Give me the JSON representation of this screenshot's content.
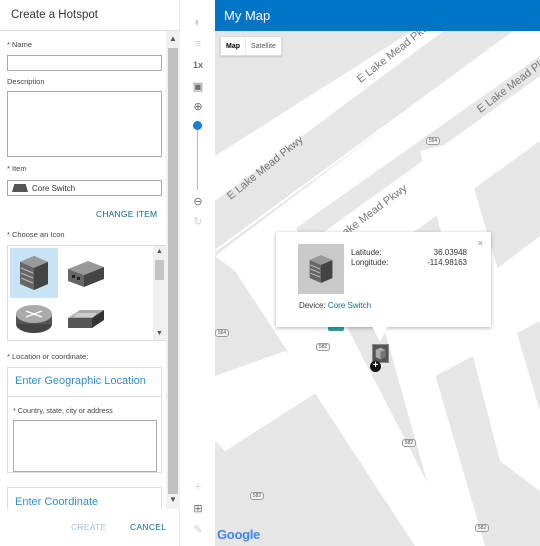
{
  "panel": {
    "title": "Create a Hotspot",
    "name_label": "* Name",
    "name_value": "",
    "description_label": "Description",
    "description_value": "",
    "item_label": "* Item",
    "item_value": "Core Switch",
    "change_item": "CHANGE ITEM",
    "choose_icon_label": "* Choose an Icon",
    "icons": [
      "server-icon",
      "building-icon",
      "router-icon",
      "switch-icon"
    ],
    "location_label": "* Location or coordinate:",
    "geo_location_title": "Enter Geographic Location",
    "geo_location_hint": "* Country, state, city or address",
    "coordinate_title": "Enter Coordinate",
    "create_button": "CREATE",
    "cancel_button": "CANCEL"
  },
  "map": {
    "title": "My Map",
    "map_type_active": "Map",
    "map_type_inactive": "Satellite",
    "roads": [
      "E Lake Mead Pkwy",
      "E Lake Mead Pkwy",
      "E Lake Mead Pkwy",
      "E Lake Mead Pkwy"
    ],
    "shields": [
      "564",
      "564",
      "582",
      "582",
      "582",
      "582"
    ],
    "logo": "Google",
    "popup": {
      "latitude_label": "Latitude:",
      "latitude_value": "36.03948",
      "longitude_label": "Longitude:",
      "longitude_value": "-114.98163",
      "device_label": "Device:",
      "device_value": "Core Switch",
      "close": "×"
    }
  },
  "toolbar": {
    "zoom_level_text": "1x"
  },
  "colors": {
    "header_blue": "#0275c7",
    "link_blue": "#0a6b9e",
    "title_blue": "#2d8fd5",
    "selected_bg": "#c8e3f5"
  }
}
